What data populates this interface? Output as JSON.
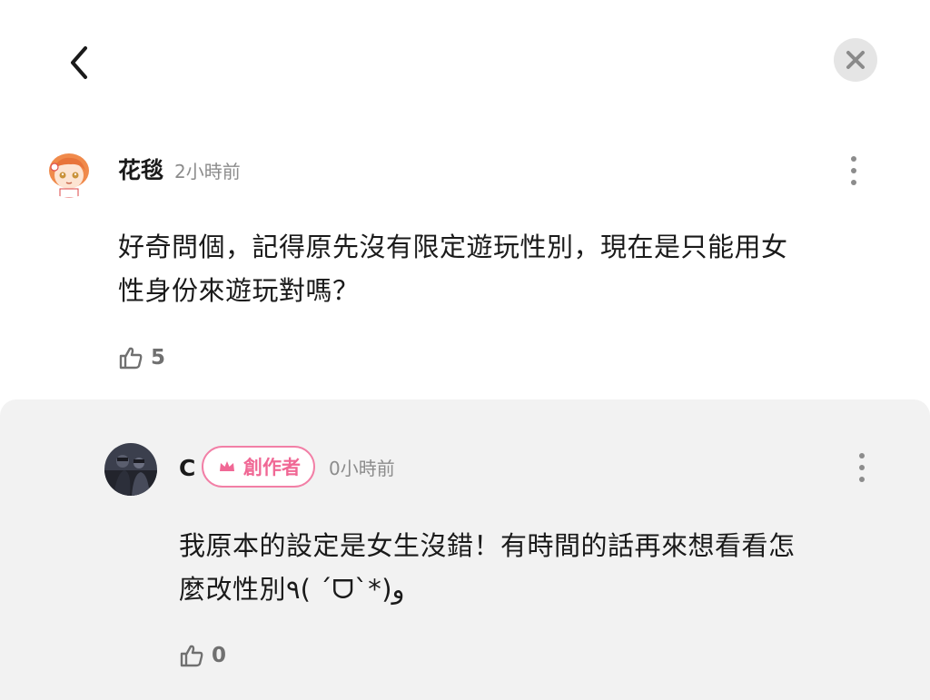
{
  "header": {
    "back_icon": "chevron-left-icon",
    "close_icon": "close-icon"
  },
  "comment": {
    "author": "花毯",
    "time": "2小時前",
    "text_line1": "好奇問個，記得原先沒有限定遊玩性別，現在是只能用女",
    "text_line2": "性身份來遊玩對嗎？",
    "likes": "5"
  },
  "reply": {
    "author": "C",
    "badge": "創作者",
    "time": "0小時前",
    "text_line1": "我原本的設定是女生沒錯！有時間的話再來想看看怎",
    "text_line2": "麼改性別٩( ˊᗜˋ*)و",
    "likes": "0"
  },
  "colors": {
    "badge_pink": "#f06895",
    "reply_background": "#f2f2f2",
    "secondary_text": "#8c8c8c"
  }
}
